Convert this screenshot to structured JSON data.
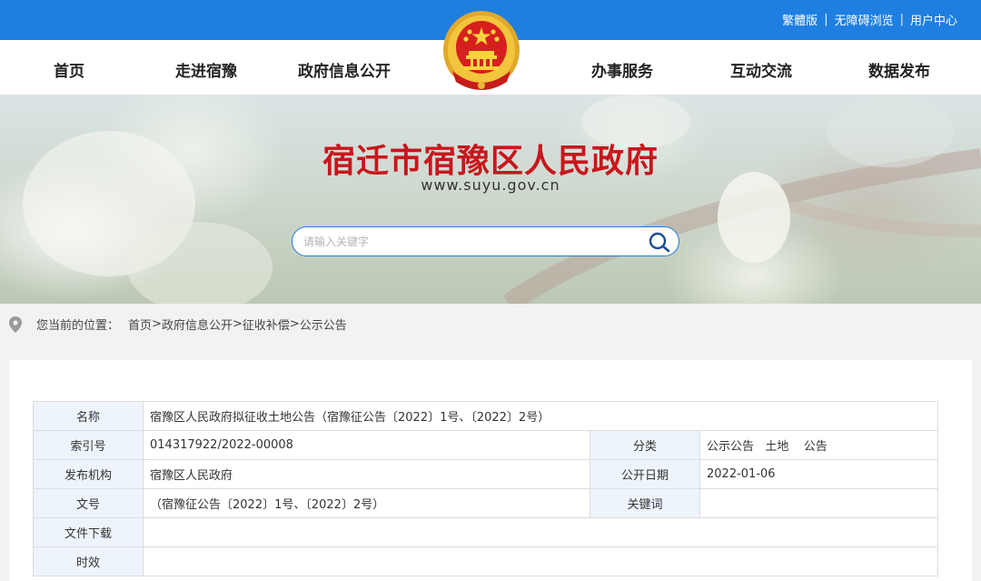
{
  "toplinks": [
    "繁體版",
    "无障碍浏览",
    "用户中心"
  ],
  "nav": [
    "首页",
    "走进宿豫",
    "政府信息公开",
    "办事服务",
    "互动交流",
    "数据发布"
  ],
  "banner": {
    "title": "宿迁市宿豫区人民政府",
    "url": "www.suyu.gov.cn"
  },
  "search": {
    "placeholder": "请输入关键字",
    "value": ""
  },
  "breadcrumb": {
    "lead": "您当前的位置：",
    "items": [
      "首页",
      "政府信息公开",
      "征收补偿",
      "公示公告"
    ],
    "sep": ">"
  },
  "info": {
    "name_label": "名称",
    "name_value": "宿豫区人民政府拟征收土地公告（宿豫征公告〔2022〕1号、〔2022〕2号）",
    "index_label": "索引号",
    "index_value": "014317922/2022-00008",
    "category_label": "分类",
    "category_value": "公示公告   土地    公告",
    "org_label": "发布机构",
    "org_value": "宿豫区人民政府",
    "date_label": "公开日期",
    "date_value": "2022-01-06",
    "docno_label": "文号",
    "docno_value": "（宿豫征公告〔2022〕1号、〔2022〕2号）",
    "keyword_label": "关键词",
    "keyword_value": "",
    "download_label": "文件下载",
    "download_value": "",
    "validity_label": "时效",
    "validity_value": ""
  },
  "colors": {
    "brand_blue": "#1e7fe0",
    "title_red": "#c8161d",
    "label_bg": "#eef4fc"
  },
  "icons": [
    "national-emblem-icon",
    "search-icon",
    "location-pin-icon"
  ]
}
